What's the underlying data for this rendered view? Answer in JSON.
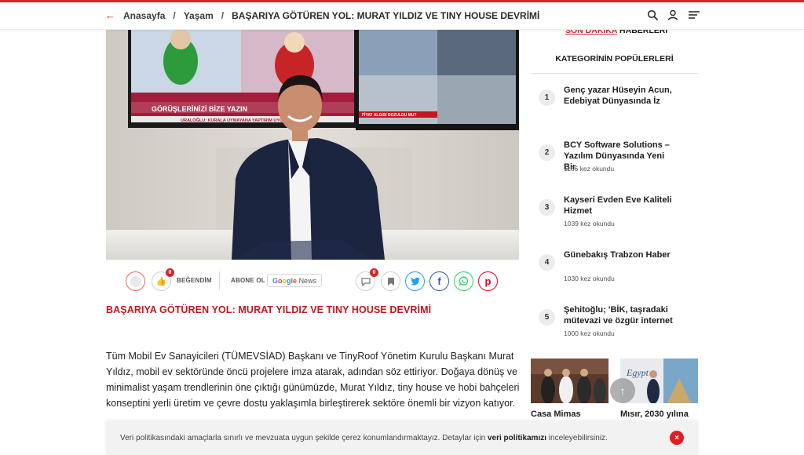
{
  "header": {
    "breadcrumb": {
      "home": "Anasayfa",
      "category": "Yaşam",
      "current": "BAŞARIYA GÖTÜREN YOL: MURAT YILDIZ VE TINY HOUSE DEVRİMİ"
    },
    "icons": [
      "search-icon",
      "user-icon",
      "menu-icon"
    ]
  },
  "hero": {
    "tv_left_text": "GÖRÜŞLERİNİZİ BİZE YAZIN",
    "tv_left_ticker": "URALOĞLU: KURALA UYMAYANA YAPTIRIM UYGULA",
    "tv_right_ticker": "FİYAT ALGISI BOZULDU MU?"
  },
  "actions": {
    "like_count": "0",
    "like_label": "BEĞENDİM",
    "subscribe_label": "ABONE OL",
    "google_news_label": "News",
    "comment_count": "0"
  },
  "article": {
    "headline": "BAŞARIYA GÖTÜREN YOL: MURAT YILDIZ VE TINY HOUSE DEVRİMİ",
    "paragraph": "Tüm Mobil Ev Sanayicileri  (TÜMEVSİAD) Başkanı ve TinyRoof Yönetim Kurulu Başkanı Murat Yıldız, mobil ev sektöründe öncü projelere imza atarak, adından söz ettiriyor. Doğaya dönüş ve minimalist yaşam trendlerinin öne çıktığı günümüzde, Murat Yıldız, tiny house ve hobi bahçeleri konseptini yerli üretim ve çevre dostu yaklaşımla birleştirerek sektöre önemli bir vizyon katıyor."
  },
  "sidebar": {
    "top_red": "SON DAKİKA",
    "top_rest": "HABERLERİ",
    "title": "KATEGORİNİN POPÜLERLERİ",
    "popular": [
      {
        "num": "1",
        "title": "Genç yazar Hüseyin Acun, Edebiyat Dünyasında İz",
        "count": ""
      },
      {
        "num": "2",
        "title": "BCY Software Solutions – Yazılım Dünyasında Yeni Bir",
        "count": "1166 kez okundu"
      },
      {
        "num": "3",
        "title": "Kayseri Evden Eve Kaliteli Hizmet",
        "count": "1039 kez okundu"
      },
      {
        "num": "4",
        "title": "Günebakış Trabzon Haber",
        "count": "1030 kez okundu"
      },
      {
        "num": "5",
        "title": "Şehitoğlu; 'BİK, taşradaki mütevazi ve özgür internet",
        "count": "1000 kez okundu"
      }
    ],
    "thumbs": [
      {
        "caption": "Casa Mimas"
      },
      {
        "caption": "Mısır, 2030 yılına"
      }
    ]
  },
  "cookie": {
    "text_before": "Veri politikasındaki amaçlarla sınırlı ve mevzuata uygun şekilde çerez konumlandırmaktayız. Detaylar için ",
    "link": "veri politikamızı",
    "text_after": " inceleyebilirsiniz.",
    "close": "×"
  },
  "colors": {
    "accent": "#d6262a",
    "facebook": "#3b5998",
    "twitter": "#1da1f2",
    "whatsapp": "#25d366",
    "pinterest": "#e60023"
  }
}
